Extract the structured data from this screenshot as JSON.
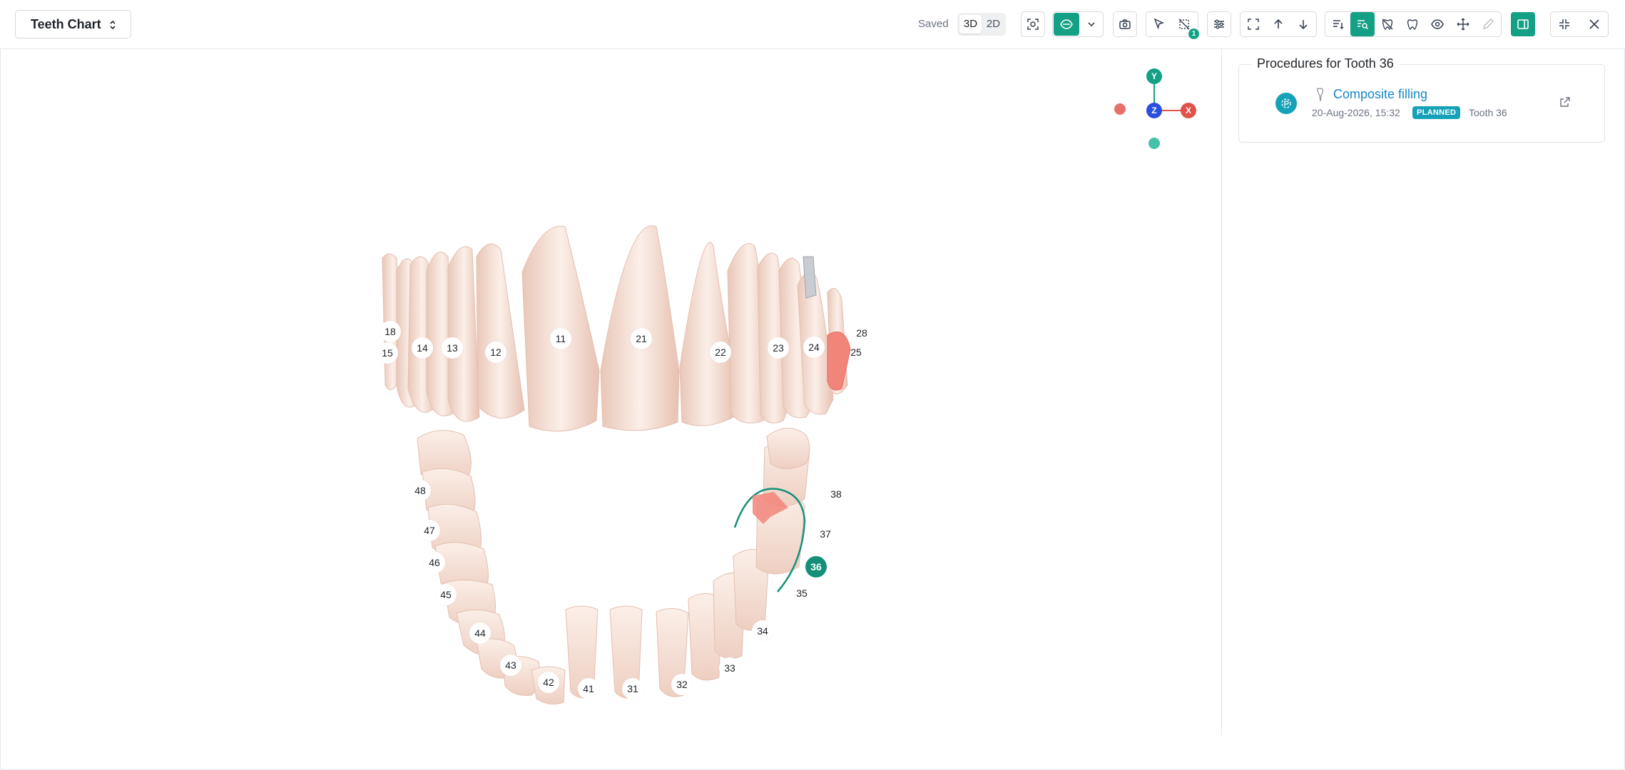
{
  "header": {
    "chart_selector": "Teeth Chart",
    "save_status": "Saved",
    "view_modes": [
      "3D",
      "2D"
    ],
    "active_view": "3D",
    "notification_count": "1"
  },
  "toolbar_icons": [
    "focus-view-icon",
    "eye-view-icon",
    "chevron-down-icon",
    "camera-icon",
    "select-cursor-icon",
    "hide-selection-icon",
    "sliders-icon",
    "fit-view-icon",
    "arrow-up-icon",
    "arrow-down-icon",
    "sort-list-icon",
    "search-list-icon",
    "hide-tooth-icon",
    "tooth-model-icon",
    "visibility-icon",
    "move-icon",
    "pencil-icon",
    "sidebar-toggle-icon",
    "collapse-icon",
    "close-icon"
  ],
  "axis_gizmo": {
    "y": "Y",
    "z": "Z",
    "x": "X"
  },
  "teeth": {
    "upper": [
      "18",
      "15",
      "14",
      "13",
      "12",
      "11",
      "21",
      "22",
      "23",
      "24",
      "25",
      "28"
    ],
    "lower": [
      "48",
      "47",
      "46",
      "45",
      "44",
      "43",
      "42",
      "41",
      "31",
      "32",
      "33",
      "34",
      "35",
      "36",
      "37",
      "38"
    ],
    "selected": "36"
  },
  "procedures_panel": {
    "title": "Procedures for Tooth 36",
    "items": [
      {
        "name": "Composite filling",
        "datetime": "20-Aug-2026, 15:32",
        "status": "PLANNED",
        "tooth": "Tooth 36"
      }
    ]
  },
  "colors": {
    "accent": "#14a085",
    "status_planned": "#15a2b8",
    "link": "#1688c7",
    "tooth_fill": "#f6e3da",
    "caries": "#f08070"
  }
}
